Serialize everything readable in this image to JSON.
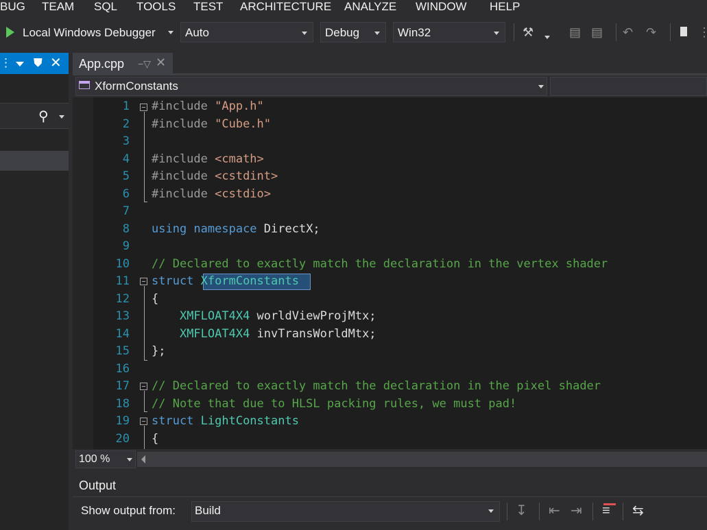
{
  "menu": {
    "items": [
      "BUG",
      "TEAM",
      "SQL",
      "TOOLS",
      "TEST",
      "ARCHITECTURE",
      "ANALYZE",
      "WINDOW",
      "HELP"
    ]
  },
  "toolbar": {
    "debugger_label": "Local Windows Debugger",
    "solution_config": "Auto",
    "build_config": "Debug",
    "platform": "Win32"
  },
  "editor": {
    "tab_title": "App.cpp",
    "nav_member": "XformConstants",
    "zoom": "100 %",
    "lines": [
      {
        "n": "1",
        "parts": [
          {
            "t": "#include ",
            "c": "pre"
          },
          {
            "t": "\"App.h\"",
            "c": "str"
          }
        ]
      },
      {
        "n": "2",
        "parts": [
          {
            "t": "#include ",
            "c": "pre"
          },
          {
            "t": "\"Cube.h\"",
            "c": "str"
          }
        ]
      },
      {
        "n": "3",
        "parts": []
      },
      {
        "n": "4",
        "parts": [
          {
            "t": "#include ",
            "c": "pre"
          },
          {
            "t": "<cmath>",
            "c": "str"
          }
        ]
      },
      {
        "n": "5",
        "parts": [
          {
            "t": "#include ",
            "c": "pre"
          },
          {
            "t": "<cstdint>",
            "c": "str"
          }
        ]
      },
      {
        "n": "6",
        "parts": [
          {
            "t": "#include ",
            "c": "pre"
          },
          {
            "t": "<cstdio>",
            "c": "str"
          }
        ]
      },
      {
        "n": "7",
        "parts": []
      },
      {
        "n": "8",
        "parts": [
          {
            "t": "using ",
            "c": "kw"
          },
          {
            "t": "namespace ",
            "c": "kw"
          },
          {
            "t": "DirectX;",
            "c": "plain"
          }
        ]
      },
      {
        "n": "9",
        "parts": []
      },
      {
        "n": "10",
        "parts": [
          {
            "t": "// Declared to exactly match the declaration in the vertex shader",
            "c": "cmt"
          }
        ]
      },
      {
        "n": "11",
        "parts": [
          {
            "t": "struct ",
            "c": "kw"
          },
          {
            "t": "XformConstants",
            "c": "type"
          }
        ]
      },
      {
        "n": "12",
        "parts": [
          {
            "t": "{",
            "c": "plain"
          }
        ]
      },
      {
        "n": "13",
        "parts": [
          {
            "t": "    ",
            "c": "plain"
          },
          {
            "t": "XMFLOAT4X4",
            "c": "type"
          },
          {
            "t": " worldViewProjMtx;",
            "c": "plain"
          }
        ]
      },
      {
        "n": "14",
        "parts": [
          {
            "t": "    ",
            "c": "plain"
          },
          {
            "t": "XMFLOAT4X4",
            "c": "type"
          },
          {
            "t": " invTransWorldMtx;",
            "c": "plain"
          }
        ]
      },
      {
        "n": "15",
        "parts": [
          {
            "t": "};",
            "c": "plain"
          }
        ]
      },
      {
        "n": "16",
        "parts": []
      },
      {
        "n": "17",
        "parts": [
          {
            "t": "// Declared to exactly match the declaration in the pixel shader",
            "c": "cmt"
          }
        ]
      },
      {
        "n": "18",
        "parts": [
          {
            "t": "// Note that due to HLSL packing rules, we must pad!",
            "c": "cmt"
          }
        ]
      },
      {
        "n": "19",
        "parts": [
          {
            "t": "struct ",
            "c": "kw"
          },
          {
            "t": "LightConstants",
            "c": "type"
          }
        ]
      },
      {
        "n": "20",
        "parts": [
          {
            "t": "{",
            "c": "plain"
          }
        ]
      }
    ]
  },
  "output": {
    "title": "Output",
    "show_label": "Show output from:",
    "source": "Build"
  },
  "colors": {
    "accent": "#007acc",
    "keyword": "#569cd6",
    "type": "#4ec9b0",
    "comment": "#57a64a",
    "string": "#d69d85",
    "line_number": "#2b91af"
  }
}
